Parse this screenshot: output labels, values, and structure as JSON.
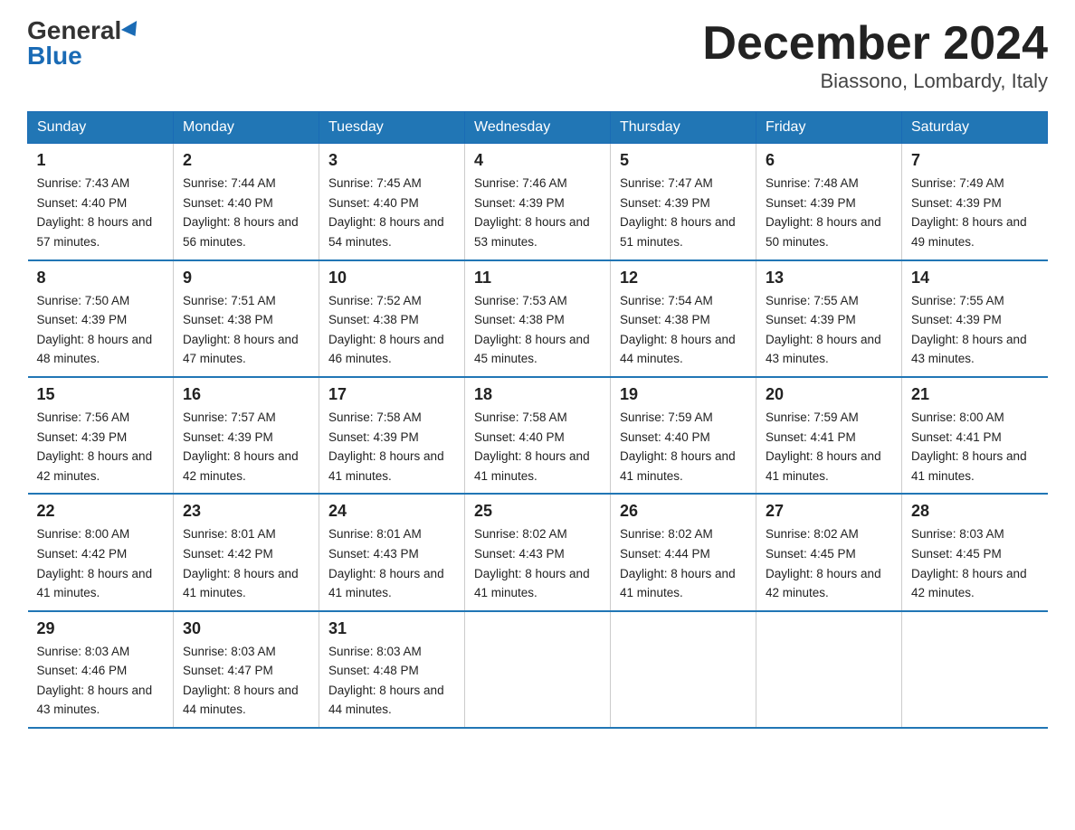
{
  "logo": {
    "general": "General",
    "blue": "Blue"
  },
  "title": "December 2024",
  "subtitle": "Biassono, Lombardy, Italy",
  "days_of_week": [
    "Sunday",
    "Monday",
    "Tuesday",
    "Wednesday",
    "Thursday",
    "Friday",
    "Saturday"
  ],
  "weeks": [
    [
      {
        "day": "1",
        "sunrise": "7:43 AM",
        "sunset": "4:40 PM",
        "daylight": "8 hours and 57 minutes."
      },
      {
        "day": "2",
        "sunrise": "7:44 AM",
        "sunset": "4:40 PM",
        "daylight": "8 hours and 56 minutes."
      },
      {
        "day": "3",
        "sunrise": "7:45 AM",
        "sunset": "4:40 PM",
        "daylight": "8 hours and 54 minutes."
      },
      {
        "day": "4",
        "sunrise": "7:46 AM",
        "sunset": "4:39 PM",
        "daylight": "8 hours and 53 minutes."
      },
      {
        "day": "5",
        "sunrise": "7:47 AM",
        "sunset": "4:39 PM",
        "daylight": "8 hours and 51 minutes."
      },
      {
        "day": "6",
        "sunrise": "7:48 AM",
        "sunset": "4:39 PM",
        "daylight": "8 hours and 50 minutes."
      },
      {
        "day": "7",
        "sunrise": "7:49 AM",
        "sunset": "4:39 PM",
        "daylight": "8 hours and 49 minutes."
      }
    ],
    [
      {
        "day": "8",
        "sunrise": "7:50 AM",
        "sunset": "4:39 PM",
        "daylight": "8 hours and 48 minutes."
      },
      {
        "day": "9",
        "sunrise": "7:51 AM",
        "sunset": "4:38 PM",
        "daylight": "8 hours and 47 minutes."
      },
      {
        "day": "10",
        "sunrise": "7:52 AM",
        "sunset": "4:38 PM",
        "daylight": "8 hours and 46 minutes."
      },
      {
        "day": "11",
        "sunrise": "7:53 AM",
        "sunset": "4:38 PM",
        "daylight": "8 hours and 45 minutes."
      },
      {
        "day": "12",
        "sunrise": "7:54 AM",
        "sunset": "4:38 PM",
        "daylight": "8 hours and 44 minutes."
      },
      {
        "day": "13",
        "sunrise": "7:55 AM",
        "sunset": "4:39 PM",
        "daylight": "8 hours and 43 minutes."
      },
      {
        "day": "14",
        "sunrise": "7:55 AM",
        "sunset": "4:39 PM",
        "daylight": "8 hours and 43 minutes."
      }
    ],
    [
      {
        "day": "15",
        "sunrise": "7:56 AM",
        "sunset": "4:39 PM",
        "daylight": "8 hours and 42 minutes."
      },
      {
        "day": "16",
        "sunrise": "7:57 AM",
        "sunset": "4:39 PM",
        "daylight": "8 hours and 42 minutes."
      },
      {
        "day": "17",
        "sunrise": "7:58 AM",
        "sunset": "4:39 PM",
        "daylight": "8 hours and 41 minutes."
      },
      {
        "day": "18",
        "sunrise": "7:58 AM",
        "sunset": "4:40 PM",
        "daylight": "8 hours and 41 minutes."
      },
      {
        "day": "19",
        "sunrise": "7:59 AM",
        "sunset": "4:40 PM",
        "daylight": "8 hours and 41 minutes."
      },
      {
        "day": "20",
        "sunrise": "7:59 AM",
        "sunset": "4:41 PM",
        "daylight": "8 hours and 41 minutes."
      },
      {
        "day": "21",
        "sunrise": "8:00 AM",
        "sunset": "4:41 PM",
        "daylight": "8 hours and 41 minutes."
      }
    ],
    [
      {
        "day": "22",
        "sunrise": "8:00 AM",
        "sunset": "4:42 PM",
        "daylight": "8 hours and 41 minutes."
      },
      {
        "day": "23",
        "sunrise": "8:01 AM",
        "sunset": "4:42 PM",
        "daylight": "8 hours and 41 minutes."
      },
      {
        "day": "24",
        "sunrise": "8:01 AM",
        "sunset": "4:43 PM",
        "daylight": "8 hours and 41 minutes."
      },
      {
        "day": "25",
        "sunrise": "8:02 AM",
        "sunset": "4:43 PM",
        "daylight": "8 hours and 41 minutes."
      },
      {
        "day": "26",
        "sunrise": "8:02 AM",
        "sunset": "4:44 PM",
        "daylight": "8 hours and 41 minutes."
      },
      {
        "day": "27",
        "sunrise": "8:02 AM",
        "sunset": "4:45 PM",
        "daylight": "8 hours and 42 minutes."
      },
      {
        "day": "28",
        "sunrise": "8:03 AM",
        "sunset": "4:45 PM",
        "daylight": "8 hours and 42 minutes."
      }
    ],
    [
      {
        "day": "29",
        "sunrise": "8:03 AM",
        "sunset": "4:46 PM",
        "daylight": "8 hours and 43 minutes."
      },
      {
        "day": "30",
        "sunrise": "8:03 AM",
        "sunset": "4:47 PM",
        "daylight": "8 hours and 44 minutes."
      },
      {
        "day": "31",
        "sunrise": "8:03 AM",
        "sunset": "4:48 PM",
        "daylight": "8 hours and 44 minutes."
      },
      null,
      null,
      null,
      null
    ]
  ]
}
